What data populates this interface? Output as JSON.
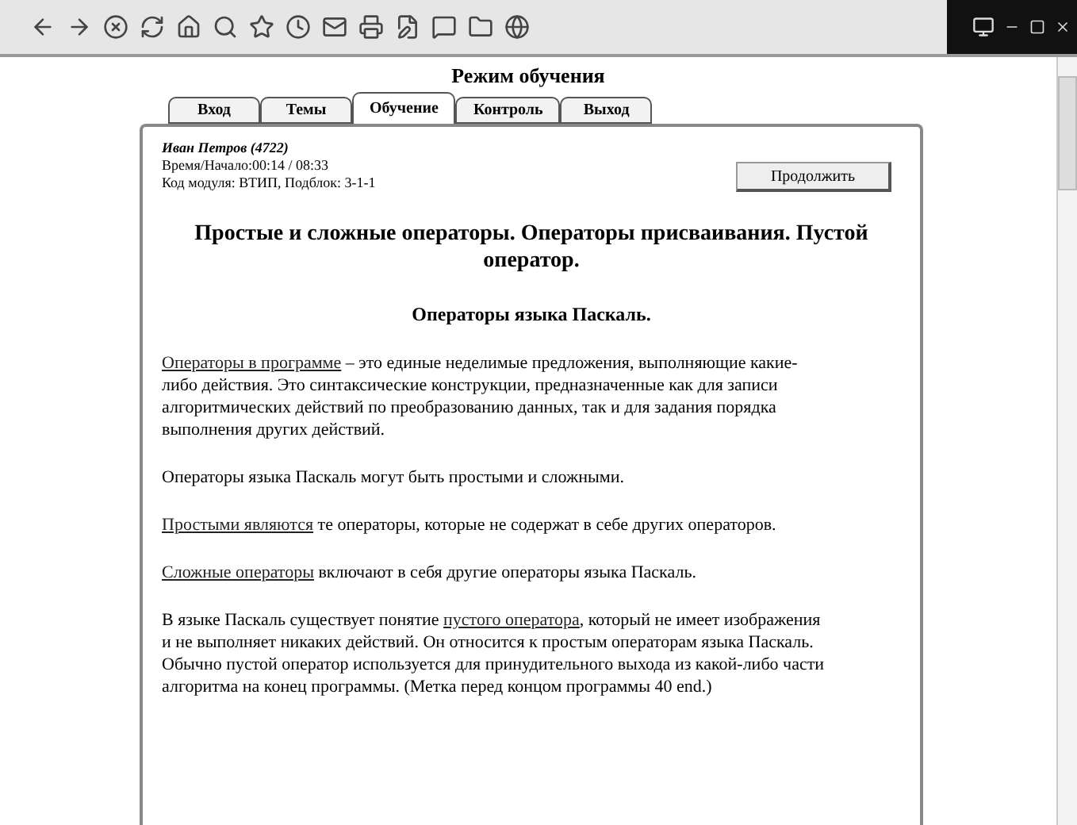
{
  "page_title": "Режим обучения",
  "tabs": [
    {
      "label": "Вход",
      "selected": false
    },
    {
      "label": "Темы",
      "selected": false
    },
    {
      "label": "Обучение",
      "selected": true
    },
    {
      "label": "Контроль",
      "selected": false
    },
    {
      "label": "Выход",
      "selected": false
    }
  ],
  "info_lines": [
    "Иван Петров (4722)",
    "Время/Начало:00:14 / 08:33",
    "Код модуля: ВТИП, Подблок: 3-1-1"
  ],
  "continue_button": "Продолжить",
  "heading": "Простые и сложные операторы. Операторы присваивания. Пустой оператор.",
  "subheading": "Операторы языка Паскаль.",
  "paragraphs": [
    [
      {
        "text": "Операторы в программе",
        "link": true
      },
      {
        "text": " – это единые неделимые предложения, выполняющие какие-либо действия. Это синтаксические конструкции, предназначенные как для записи алгоритмических действий по преобразованию данных, так и для задания порядка выполнения других действий.",
        "link": false
      }
    ],
    [
      {
        "text": "Операторы языка Паскаль могут быть простыми и сложными.",
        "link": false
      }
    ],
    [
      {
        "text": "Простыми являются",
        "link": true
      },
      {
        "text": " те операторы, которые не содержат в себе других операторов.",
        "link": false
      }
    ],
    [
      {
        "text": "Сложные операторы",
        "link": true
      },
      {
        "text": " включают в себя другие операторы языка Паскаль.",
        "link": false
      }
    ],
    [
      {
        "text": "В языке Паскаль существует понятие ",
        "link": false
      },
      {
        "text": "пустого оператора",
        "link": true
      },
      {
        "text": ", который не имеет изображения и не выполняет никаких действий. Он относится к простым операторам языка Паскаль. Обычно пустой оператор используется для принудительного выхода из какой-либо части алгоритма на конец программы. (Метка перед концом программы 40 end.)",
        "link": false
      }
    ]
  ]
}
